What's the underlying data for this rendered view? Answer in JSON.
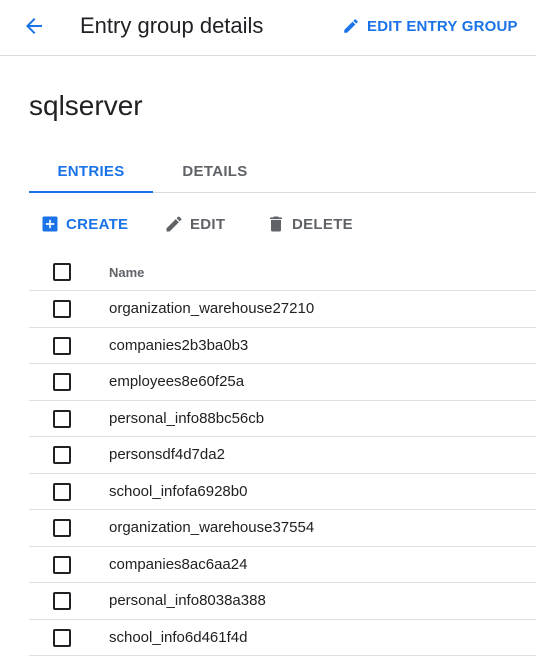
{
  "header": {
    "back_icon": "arrow-back-icon",
    "title": "Entry group details",
    "edit_label": "EDIT ENTRY GROUP",
    "edit_icon": "pencil-icon"
  },
  "page_title": "sqlserver",
  "tabs": [
    {
      "label": "ENTRIES",
      "active": true
    },
    {
      "label": "DETAILS",
      "active": false
    }
  ],
  "toolbar": {
    "create_label": "CREATE",
    "create_icon": "add-box-icon",
    "edit_label": "EDIT",
    "edit_icon": "pencil-icon",
    "delete_label": "DELETE",
    "delete_icon": "trash-icon"
  },
  "table": {
    "column_header": "Name",
    "rows": [
      "organization_warehouse27210",
      "companies2b3ba0b3",
      "employees8e60f25a",
      "personal_info88bc56cb",
      "personsdf4d7da2",
      "school_infofa6928b0",
      "organization_warehouse37554",
      "companies8ac6aa24",
      "personal_info8038a388",
      "school_info6d461f4d"
    ]
  },
  "colors": {
    "accent": "#1a73e8",
    "muted": "#5f6368",
    "text": "#202124",
    "divider": "#dadce0"
  }
}
